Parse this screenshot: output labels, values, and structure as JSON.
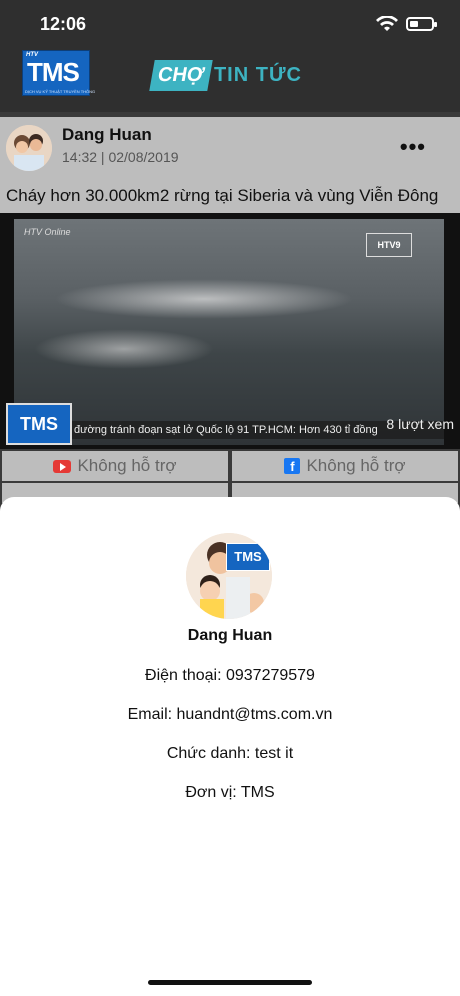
{
  "status_bar": {
    "time": "12:06"
  },
  "header": {
    "tms_logo_big": "TMS",
    "tms_logo_small": "HTV",
    "tms_logo_sub": "DỊCH VỤ KỸ THUẬT TRUYỀN THÔNG",
    "brand_box": "CHỢ",
    "brand_rest": "TIN TỨC"
  },
  "post": {
    "author": "Dang Huan",
    "date": "14:32 | 02/08/2019",
    "title": "Cháy hơn 30.000km2 rừng tại Siberia và vùng Viễn Đông",
    "video": {
      "ticker": "đường tránh đoạn sạt lở Quốc lộ 91   TP.HCM: Hơn 430 tỉ đồng",
      "channel_badge": "HTV9",
      "online_label": "HTV Online",
      "thumb_label": "TMS",
      "views": "8 lượt xem"
    },
    "share_buttons": [
      {
        "label": "Không hỗ trợ",
        "icon": "youtube-icon"
      },
      {
        "label": "Không hỗ trợ",
        "icon": "facebook-icon"
      }
    ]
  },
  "profile": {
    "name": "Dang Huan",
    "phone": "Điện thoại: 0937279579",
    "email": "Email: huandnt@tms.com.vn",
    "title": "Chức danh: test it",
    "unit": "Đơn vị: TMS",
    "badge": "TMS"
  }
}
